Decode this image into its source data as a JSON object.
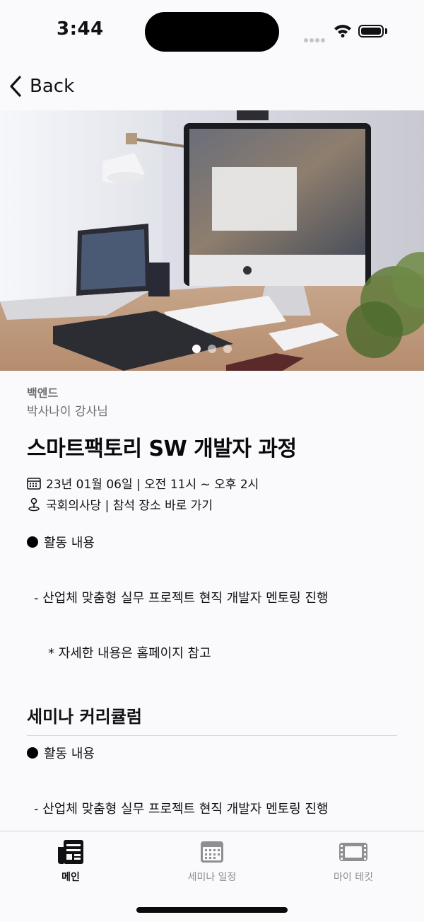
{
  "status": {
    "time": "3:44"
  },
  "nav": {
    "back_label": "Back"
  },
  "hero": {
    "image_count": 3,
    "active_index": 0
  },
  "seminar": {
    "category": "백엔드",
    "instructor": "박사나이 강사님",
    "title": "스마트팩토리 SW 개발자 과정",
    "schedule": "23년 01월 06일 | 오전 11시 ~ 오후 2시",
    "location": "국회의사당 | 참석 장소 바로 가기",
    "activity_heading": "활동 내용",
    "activity_item": "- 산업체 맞춤형 실무 프로젝트 현직 개발자 멘토링 진행",
    "activity_note": "* 자세한 내용은 홈페이지 참고"
  },
  "curriculum": {
    "title": "세미나 커리큘럼",
    "activity_heading": "활동 내용",
    "activity_item": "- 산업체 맞춤형 실무 프로젝트 현직 개발자 멘토링 진행"
  },
  "tabbar": {
    "tabs": [
      {
        "label": "메인",
        "icon": "newspaper-icon",
        "active": true
      },
      {
        "label": "세미나 일정",
        "icon": "calendar-icon",
        "active": false
      },
      {
        "label": "마이 테킷",
        "icon": "ticket-icon",
        "active": false
      }
    ]
  },
  "colors": {
    "accent": "#111111",
    "muted": "#6b6b70",
    "inactive_tab": "#8e8e93",
    "background": "#fafafc"
  }
}
